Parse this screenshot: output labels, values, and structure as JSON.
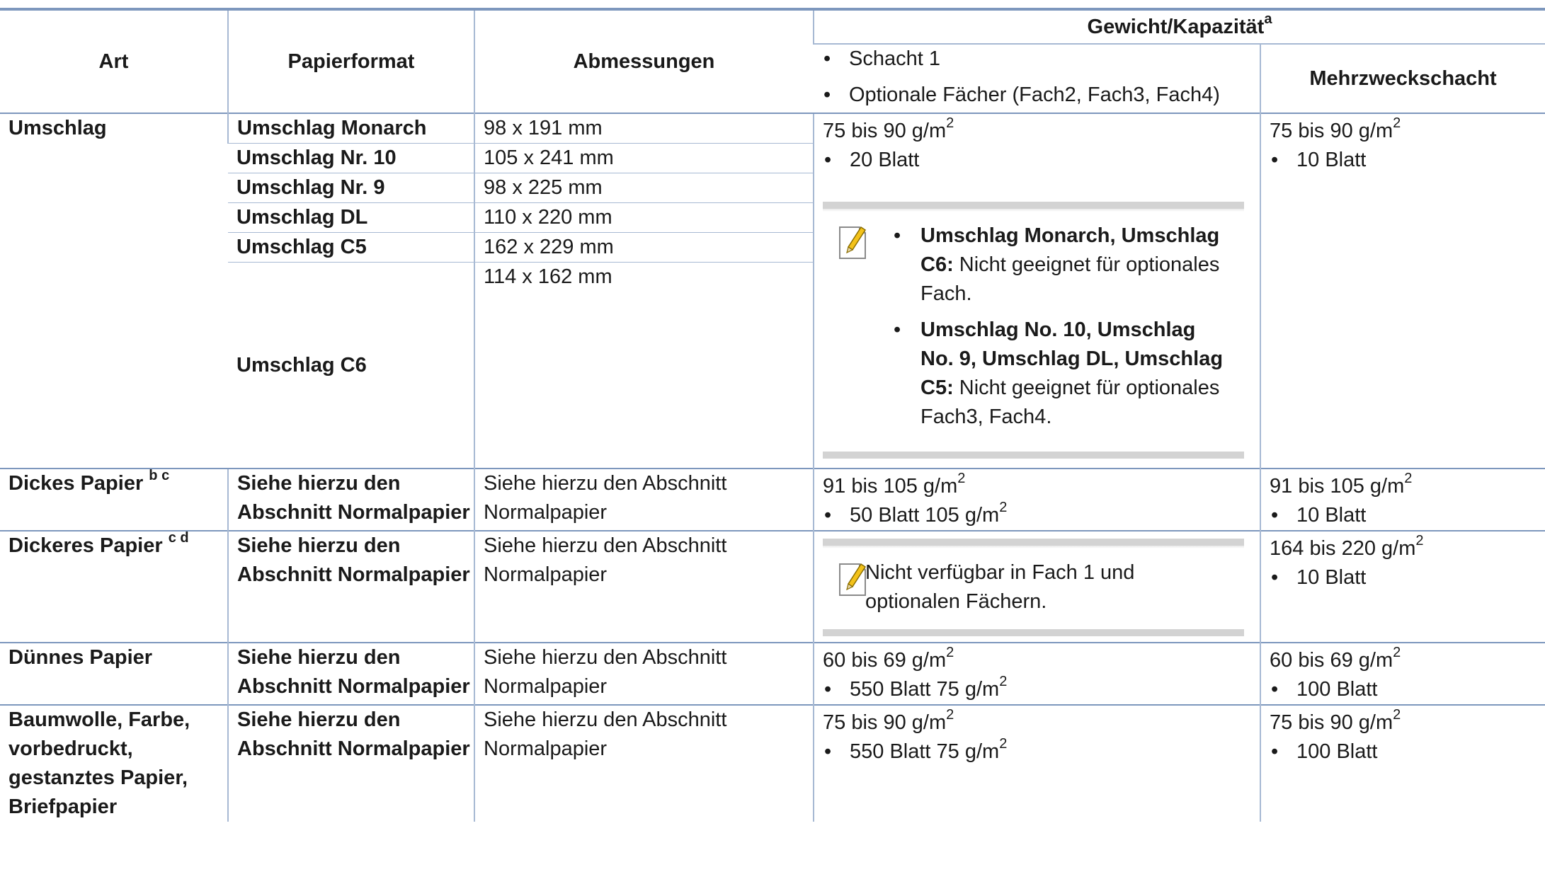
{
  "table": {
    "headers": {
      "art": "Art",
      "format": "Papierformat",
      "dims": "Abmessungen",
      "weight": "Gewicht/Kapazität",
      "weight_sup": "a",
      "tray1": "Schacht 1",
      "optional": "Optionale Fächer (Fach2, Fach3, Fach4)",
      "mp": "Mehrzweckschacht"
    },
    "umschlag": {
      "art": "Umschlag",
      "rows": [
        {
          "format": "Umschlag Monarch",
          "dims": "98 x 191 mm"
        },
        {
          "format": "Umschlag Nr. 10",
          "dims": "105 x 241 mm"
        },
        {
          "format": "Umschlag Nr. 9",
          "dims": "98 x 225 mm"
        },
        {
          "format": "Umschlag DL",
          "dims": "110 x 220 mm"
        },
        {
          "format": "Umschlag C5",
          "dims": "162 x 229 mm"
        },
        {
          "format": "Umschlag C6",
          "dims": "114 x 162 mm"
        }
      ],
      "tray_weight": "75 bis 90 g/m",
      "tray_cap": "20 Blatt",
      "note1_bold": "Umschlag Monarch, Umschlag C6:",
      "note1_text": " Nicht geeignet für optionales Fach.",
      "note2_bold": "Umschlag No. 10, Umschlag No. 9, Umschlag DL, Umschlag C5:",
      "note2_text": " Nicht geeignet für optionales Fach3, Fach4.",
      "mp_weight": "75 bis 90 g/m",
      "mp_cap": "10 Blatt"
    },
    "dickes": {
      "art": "Dickes Papier",
      "sup": "b c",
      "format": "Siehe hierzu den Abschnitt Normalpapier",
      "dims": "Siehe hierzu den Abschnitt Normalpapier",
      "tray_weight": "91 bis 105 g/m",
      "tray_cap": "50 Blatt 105 g/m",
      "mp_weight": "91 bis 105 g/m",
      "mp_cap": "10 Blatt"
    },
    "dickeres": {
      "art": "Dickeres Papier",
      "sup": "c d",
      "format": "Siehe hierzu den Abschnitt Normalpapier",
      "dims": "Siehe hierzu den Abschnitt Normalpapier",
      "note": "Nicht verfügbar in Fach 1 und optionalen Fächern.",
      "mp_weight": "164 bis 220 g/m",
      "mp_cap": "10 Blatt"
    },
    "duennes": {
      "art": "Dünnes Papier",
      "format": "Siehe hierzu den Abschnitt Normalpapier",
      "dims": "Siehe hierzu den Abschnitt Normalpapier",
      "tray_weight": "60 bis 69 g/m",
      "tray_cap": "550 Blatt 75 g/m",
      "mp_weight": "60 bis 69 g/m",
      "mp_cap": "100 Blatt"
    },
    "baumwolle": {
      "art": "Baumwolle, Farbe, vorbedruckt, gestanztes Papier, Briefpapier",
      "format": "Siehe hierzu den Abschnitt Normalpapier",
      "dims": "Siehe hierzu den Abschnitt Normalpapier",
      "tray_weight": "75 bis 90 g/m",
      "tray_cap": "550 Blatt 75 g/m",
      "mp_weight": "75 bis 90 g/m",
      "mp_cap": "100 Blatt"
    },
    "unit_sup": "2"
  }
}
